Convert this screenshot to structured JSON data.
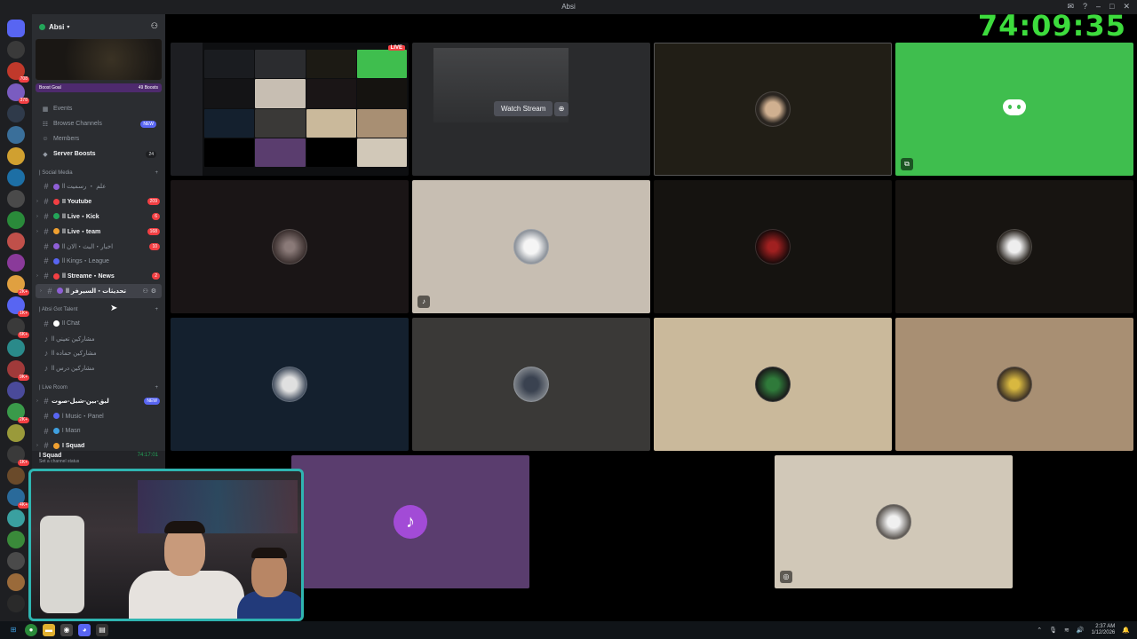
{
  "window": {
    "title": "Absi",
    "icons": [
      "inbox-icon",
      "help-icon",
      "minimize-icon",
      "maximize-icon",
      "close-icon"
    ]
  },
  "stream_timer": "74:09:35",
  "guild_badges": [
    "708",
    "378",
    "2K+",
    "1K+",
    "6K+",
    "9K+",
    "2K+",
    "1K+",
    "4K+"
  ],
  "server": {
    "name": "Absi",
    "boost_goal_label": "Boost Goal",
    "boost_count": "49 Boosts"
  },
  "nav": [
    {
      "label": "Events",
      "icon": "calendar-icon",
      "bold": false,
      "tag": ""
    },
    {
      "label": "Browse Channels",
      "icon": "browse-icon",
      "bold": false,
      "tag": "NEW"
    },
    {
      "label": "Members",
      "icon": "members-icon",
      "bold": false,
      "tag": ""
    },
    {
      "label": "Server Boosts",
      "icon": "boost-icon",
      "bold": true,
      "tag": "24"
    }
  ],
  "categories": [
    {
      "name": "| Social Media",
      "channels": [
        {
          "name": "ll علم ・ رسميت",
          "count": "",
          "unread": false,
          "color": "#8e5fd6"
        },
        {
          "name": "ll Youtube",
          "count": "209",
          "unread": true,
          "color": "#f23f43"
        },
        {
          "name": "ll Live・Kick",
          "count": "6",
          "unread": true,
          "color": "#23a559"
        },
        {
          "name": "ll Live・team",
          "count": "168",
          "unread": true,
          "color": "#f0a030"
        },
        {
          "name": "ll اخبار・البث・الان",
          "count": "10",
          "unread": false,
          "color": "#8e5fd6"
        },
        {
          "name": "ll Kings・League",
          "count": "",
          "unread": false,
          "color": "#5865f2"
        },
        {
          "name": "ll Streame・News",
          "count": "2",
          "unread": true,
          "color": "#f23f43"
        },
        {
          "name": "ll تحديثات・السيرفر",
          "count": "",
          "unread": true,
          "color": "#8e5fd6"
        }
      ]
    },
    {
      "name": "| Absi Got Talent",
      "channels": [
        {
          "name": "ll Chat",
          "count": "",
          "unread": false,
          "color": "#ffffff"
        },
        {
          "name": "ll مشاركين تعيني",
          "count": "",
          "unread": false,
          "color": ""
        },
        {
          "name": "ll مشاركين حماده",
          "count": "",
          "unread": false,
          "color": ""
        },
        {
          "name": "ll مشاركين درس",
          "count": "",
          "unread": false,
          "color": ""
        }
      ]
    },
    {
      "name": "| Live Room",
      "channels": [
        {
          "name": "ليق-بين-شبل-صوت",
          "count": "NEW",
          "unread": true,
          "color": ""
        },
        {
          "name": "l Music・Panel",
          "count": "",
          "unread": false,
          "color": "#5865f2"
        },
        {
          "name": "l Masri",
          "count": "",
          "unread": false,
          "color": "#3fa0e0"
        },
        {
          "name": "l Squad",
          "count": "",
          "unread": true,
          "color": "#f0a030"
        }
      ]
    }
  ],
  "voice": {
    "channel": "l Squad",
    "time": "74:17:01",
    "status": "Set a channel status"
  },
  "grid": {
    "watch_label": "Watch Stream",
    "live_label": "LIVE"
  },
  "taskbar": {
    "time": "2:37 AM",
    "date": "1/12/2026"
  }
}
